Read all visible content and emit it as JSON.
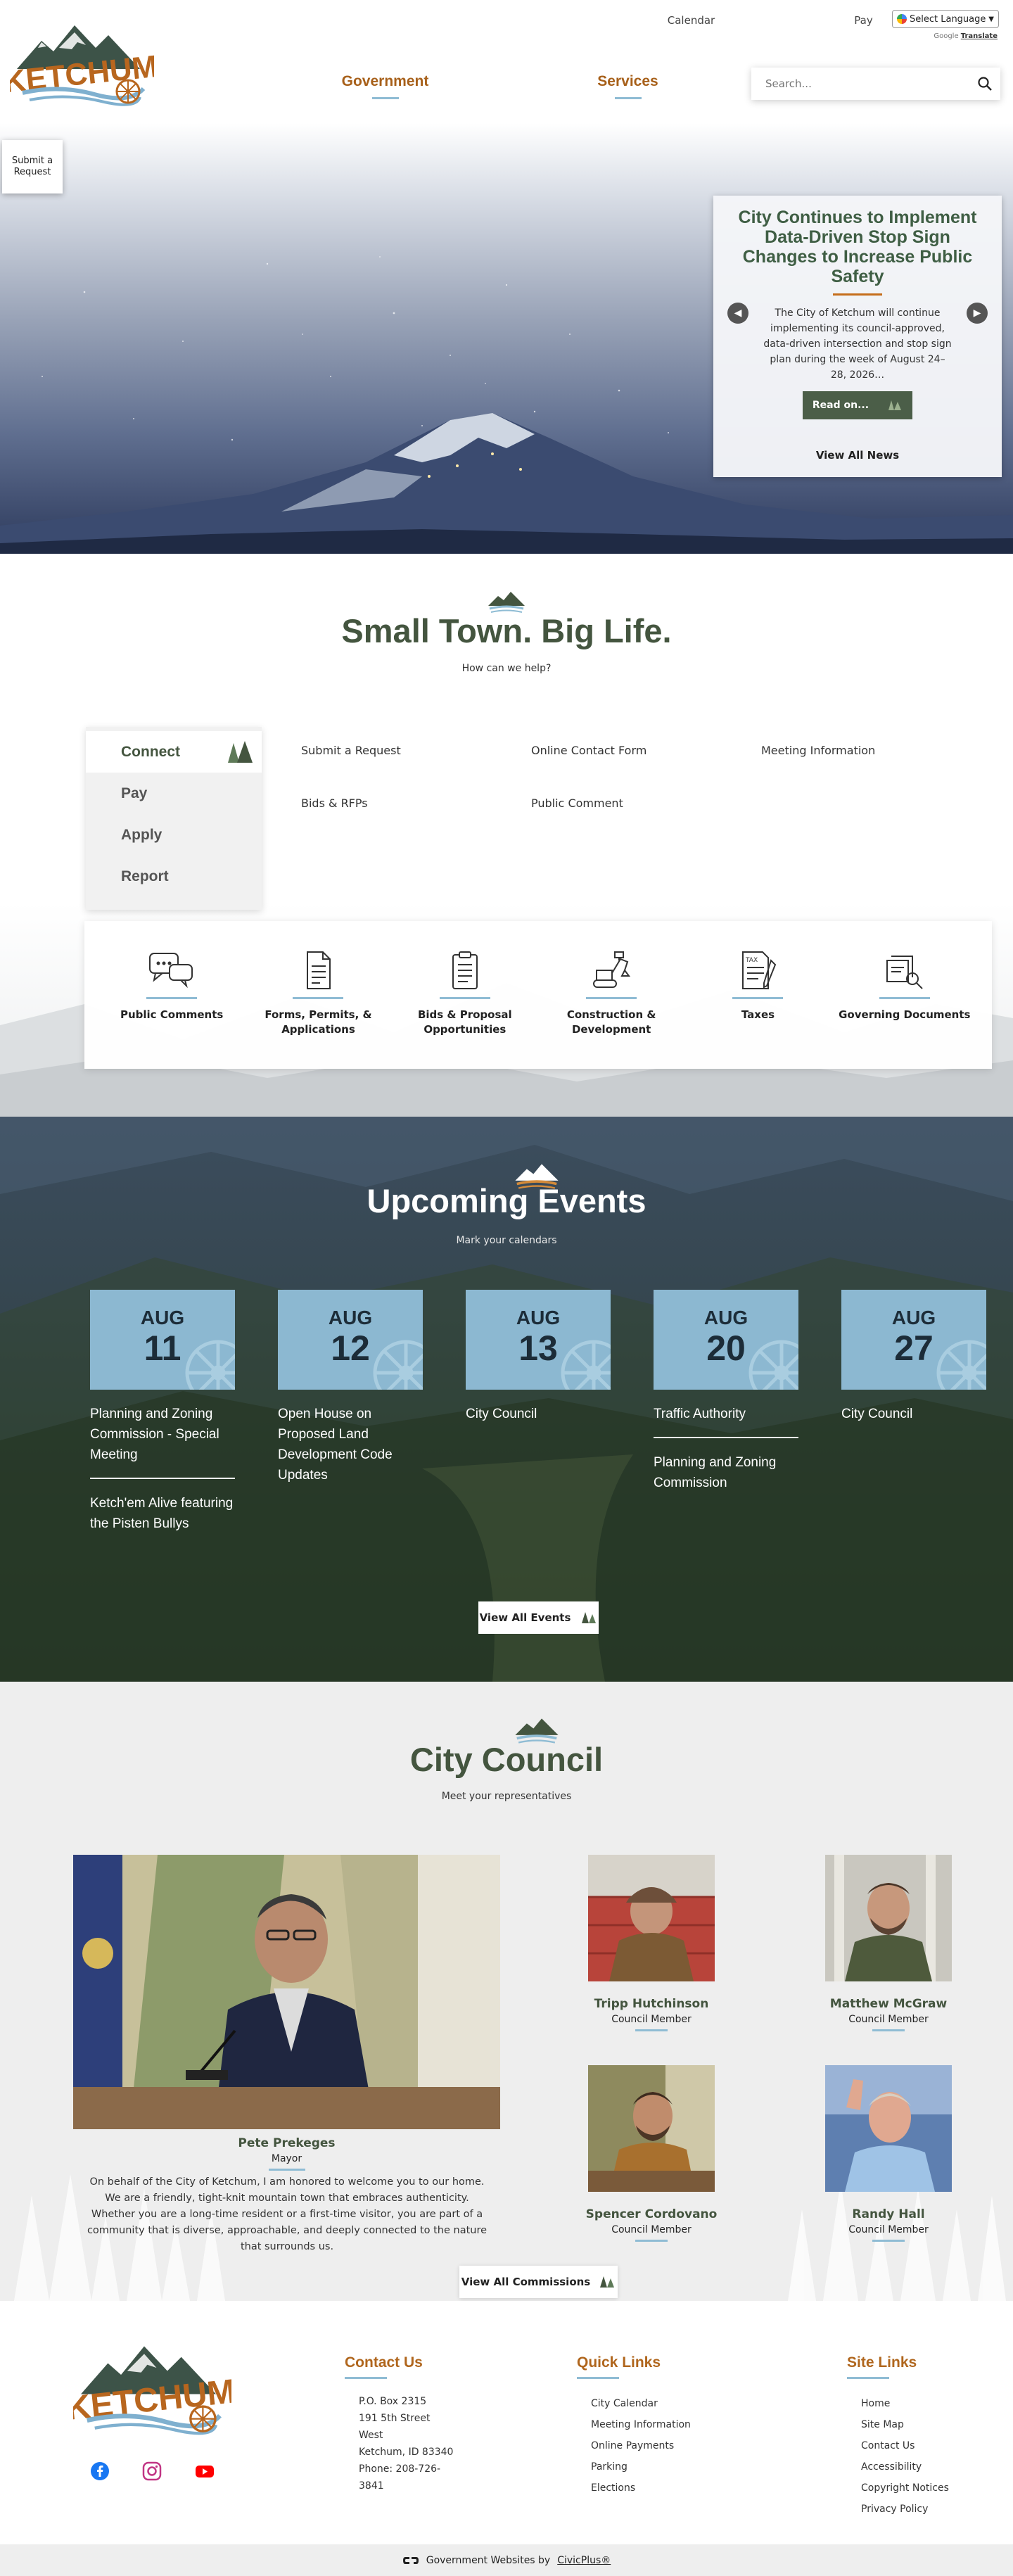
{
  "header": {
    "logo_text": "KETCHUM",
    "top_links": [
      "Calendar",
      "Pay"
    ],
    "language_select": "Select Language",
    "powered_by": "Google",
    "translate_label": "Translate",
    "nav": [
      "Government",
      "Services"
    ],
    "search_placeholder": "Search..."
  },
  "hero": {
    "submit_request": "Submit a Request",
    "news": {
      "title": "City Continues to Implement Data-Driven Stop Sign Changes to Increase Public Safety",
      "body": "The City of Ketchum will continue implementing its council-approved, data-driven intersection and stop sign plan during the week of August 24–28, 2026…",
      "read_on": "Read on...",
      "view_all": "View All News"
    }
  },
  "help": {
    "title": "Small Town. Big Life.",
    "subtitle": "How can we help?",
    "tabs": [
      "Connect",
      "Pay",
      "Apply",
      "Report"
    ],
    "links": [
      "Submit a Request",
      "Online Contact Form",
      "Meeting Information",
      "Bids & RFPs",
      "Public Comment"
    ],
    "quick": [
      {
        "label": "Public Comments",
        "icon": "speech-bubbles-icon"
      },
      {
        "label": "Forms, Permits, & Applications",
        "icon": "document-icon"
      },
      {
        "label": "Bids & Proposal Opportunities",
        "icon": "clipboard-icon"
      },
      {
        "label": "Construction & Development",
        "icon": "excavator-icon"
      },
      {
        "label": "Taxes",
        "icon": "tax-form-icon"
      },
      {
        "label": "Governing Documents",
        "icon": "document-search-icon"
      }
    ]
  },
  "events": {
    "title": "Upcoming Events",
    "subtitle": "Mark your calendars",
    "items": [
      {
        "month": "AUG",
        "day": "11",
        "titles": [
          "Planning and Zoning Commission - Special Meeting",
          "Ketch'em Alive featuring the Pisten Bullys"
        ]
      },
      {
        "month": "AUG",
        "day": "12",
        "titles": [
          "Open House on Proposed Land Development Code Updates"
        ]
      },
      {
        "month": "AUG",
        "day": "13",
        "titles": [
          "City Council"
        ]
      },
      {
        "month": "AUG",
        "day": "20",
        "titles": [
          "Traffic Authority",
          "Planning and Zoning Commission"
        ]
      },
      {
        "month": "AUG",
        "day": "27",
        "titles": [
          "City Council"
        ]
      }
    ],
    "view_all": "View All Events"
  },
  "council": {
    "title": "City Council",
    "subtitle": "Meet your representatives",
    "mayor": {
      "name": "Pete Prekeges",
      "role": "Mayor",
      "message": "On behalf of the City of Ketchum, I am honored to welcome you to our home. We are a friendly, tight-knit mountain town that embraces authenticity. Whether you are a long-time resident or a first-time visitor, you are part of a community that is diverse, approachable, and deeply connected to the nature that surrounds us."
    },
    "members": [
      {
        "name": "Tripp Hutchinson",
        "role": "Council Member"
      },
      {
        "name": "Matthew McGraw",
        "role": "Council Member"
      },
      {
        "name": "Spencer Cordovano",
        "role": "Council Member"
      },
      {
        "name": "Randy Hall",
        "role": "Council Member"
      }
    ],
    "view_all": "View All Commissions"
  },
  "footer": {
    "contact_title": "Contact Us",
    "contact_lines": [
      "P.O. Box 2315",
      "191 5th Street West",
      "Ketchum, ID 83340",
      "Phone: 208-726-3841"
    ],
    "quick_title": "Quick Links",
    "quick_links": [
      "City Calendar",
      "Meeting Information",
      "Online Payments",
      "Parking",
      "Elections"
    ],
    "site_title": "Site Links",
    "site_links": [
      "Home",
      "Site Map",
      "Contact Us",
      "Accessibility",
      "Copyright Notices",
      "Privacy Policy"
    ],
    "credit_prefix": "Government Websites by",
    "credit_link": "CivicPlus®"
  },
  "colors": {
    "brand_green": "#44553f",
    "brand_orange": "#a7601a",
    "accent_blue": "#8fbcd4"
  }
}
